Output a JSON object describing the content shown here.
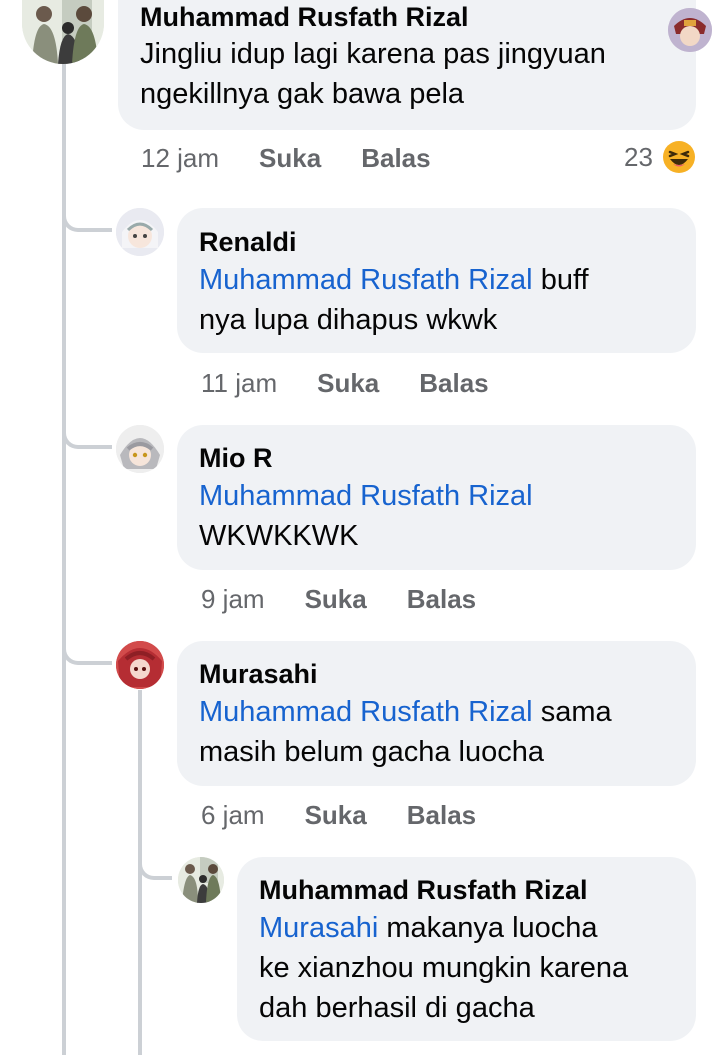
{
  "comments": [
    {
      "author": "Muhammad Rusfath Rizal",
      "text_line1": "Jingliu idup lagi karena pas jingyuan",
      "text_line2": "ngekillnya gak bawa pela",
      "time": "12 jam",
      "like_label": "Suka",
      "reply_label": "Balas",
      "reaction_count": "23"
    },
    {
      "author": "Renaldi",
      "mention": "Muhammad Rusfath Rizal",
      "text_line1_rest": " buff",
      "text_line2": "nya lupa dihapus wkwk",
      "time": "11 jam",
      "like_label": "Suka",
      "reply_label": "Balas"
    },
    {
      "author": "Mio R",
      "mention": "Muhammad Rusfath Rizal",
      "text_line2": "WKWKKWK",
      "time": "9 jam",
      "like_label": "Suka",
      "reply_label": "Balas"
    },
    {
      "author": "Murasahi",
      "mention": "Muhammad Rusfath Rizal",
      "text_line1_rest": " sama",
      "text_line2": "masih belum gacha luocha",
      "time": "6 jam",
      "like_label": "Suka",
      "reply_label": "Balas"
    },
    {
      "author": "Muhammad Rusfath Rizal",
      "mention": "Murasahi",
      "text_line1_rest": " makanya luocha",
      "text_line2": "ke xianzhou mungkin karena",
      "text_line3": "dah berhasil di gacha"
    }
  ],
  "colors": {
    "bubble": "#f0f2f5",
    "mention": "#1763cf",
    "meta": "#65676b",
    "thread_line": "#ccd0d5",
    "reaction_emoji": "#f7b125"
  },
  "icons": {
    "reaction": "laughing-emoji-icon"
  }
}
